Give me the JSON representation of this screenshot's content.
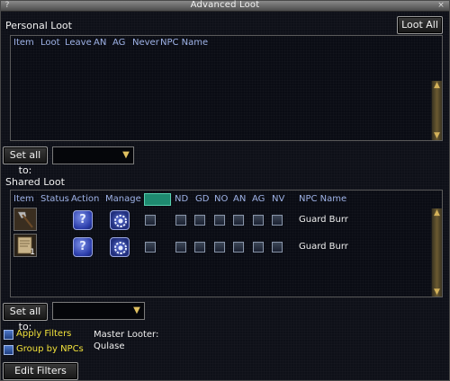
{
  "window": {
    "title": "Advanced Loot",
    "minimize_glyph": "?",
    "close_glyph": "×"
  },
  "personal": {
    "label": "Personal Loot",
    "loot_all_label": "Loot All",
    "columns": [
      "Item",
      "Loot",
      "Leave",
      "AN",
      "AG",
      "Never",
      "NPC Name"
    ],
    "set_all_label": "Set all to:"
  },
  "shared": {
    "label": "Shared Loot",
    "columns": [
      "Item",
      "Status",
      "Action",
      "Manage",
      "ND",
      "GD",
      "NO",
      "AN",
      "AG",
      "NV",
      "NPC Name"
    ],
    "rows": [
      {
        "npc": "Guard Burr",
        "item_icon": "axe-icon",
        "count": ""
      },
      {
        "npc": "Guard Burr",
        "item_icon": "scroll-icon",
        "count": "1"
      }
    ],
    "set_all_label": "Set all to:"
  },
  "filters": {
    "apply_label": "Apply Filters",
    "group_label": "Group by NPCs",
    "edit_label": "Edit Filters"
  },
  "master_looter": {
    "label": "Master Looter:",
    "name": "Qulase"
  },
  "colors": {
    "filter_label": "#f2e23a",
    "column_head": "#9fb3e8",
    "title_bar": "#6a6a6a"
  }
}
